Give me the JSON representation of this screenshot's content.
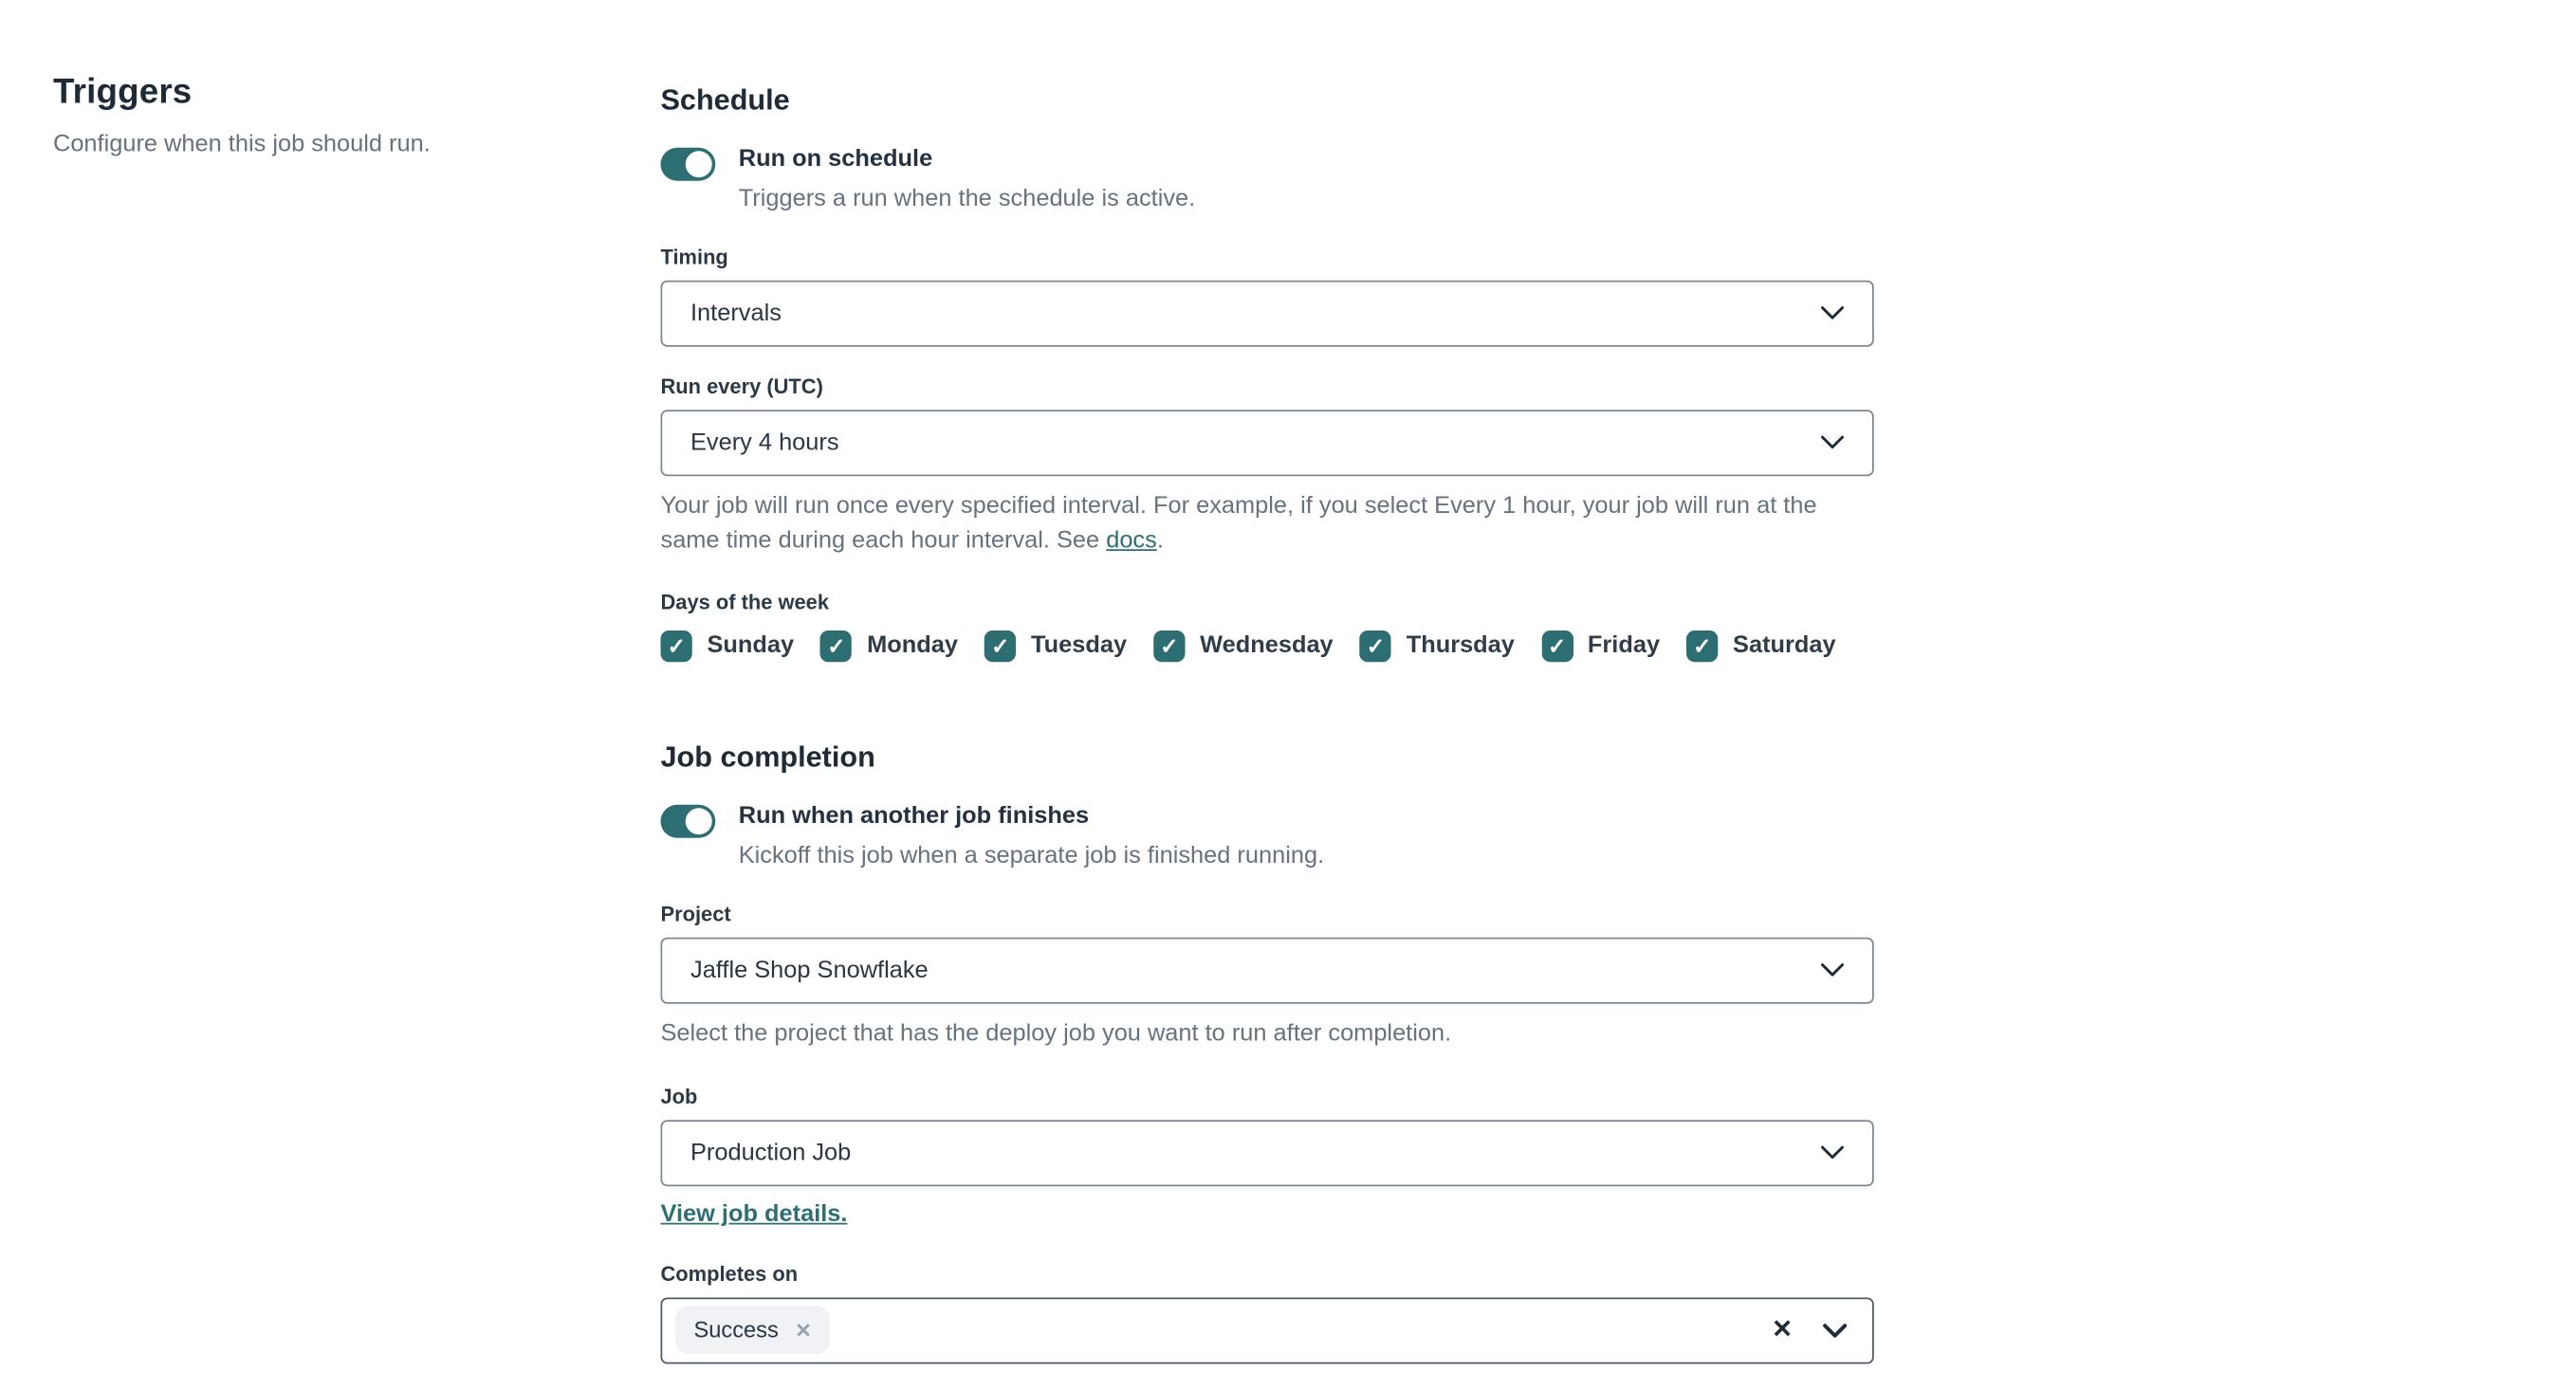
{
  "left_panel": {
    "title": "Triggers",
    "subtitle": "Configure when this job should run."
  },
  "schedule": {
    "heading": "Schedule",
    "toggle": {
      "label": "Run on schedule",
      "description": "Triggers a run when the schedule is active.",
      "state": "on"
    },
    "timing": {
      "label": "Timing",
      "value": "Intervals"
    },
    "run_every": {
      "label": "Run every (UTC)",
      "value": "Every 4 hours",
      "help_prefix": "Your job will run once every specified interval. For example, if you select Every 1 hour, your job will run at the same time during each hour interval. See ",
      "help_link": "docs",
      "help_suffix": "."
    },
    "days": {
      "label": "Days of the week",
      "items": [
        {
          "label": "Sunday",
          "checked": true
        },
        {
          "label": "Monday",
          "checked": true
        },
        {
          "label": "Tuesday",
          "checked": true
        },
        {
          "label": "Wednesday",
          "checked": true
        },
        {
          "label": "Thursday",
          "checked": true
        },
        {
          "label": "Friday",
          "checked": true
        },
        {
          "label": "Saturday",
          "checked": true
        }
      ],
      "check_glyph": "✓"
    }
  },
  "job_completion": {
    "heading": "Job completion",
    "toggle": {
      "label": "Run when another job finishes",
      "description": "Kickoff this job when a separate job is finished running.",
      "state": "on"
    },
    "project": {
      "label": "Project",
      "value": "Jaffle Shop Snowflake",
      "help": "Select the project that has the deploy job you want to run after completion."
    },
    "job": {
      "label": "Job",
      "value": "Production Job",
      "link": "View job details."
    },
    "completes_on": {
      "label": "Completes on",
      "chips": [
        {
          "label": "Success",
          "remove_glyph": "✕"
        }
      ],
      "clear_glyph": "✕"
    }
  },
  "colors": {
    "teal": "#2d6e72",
    "link_teal": "#2e6f74",
    "heading_text": "#1e2a36",
    "body_gray": "#66727e",
    "field_border": "#7d8893",
    "multiselect_border": "#4e5a67",
    "chip_bg": "#f0f2f5"
  }
}
